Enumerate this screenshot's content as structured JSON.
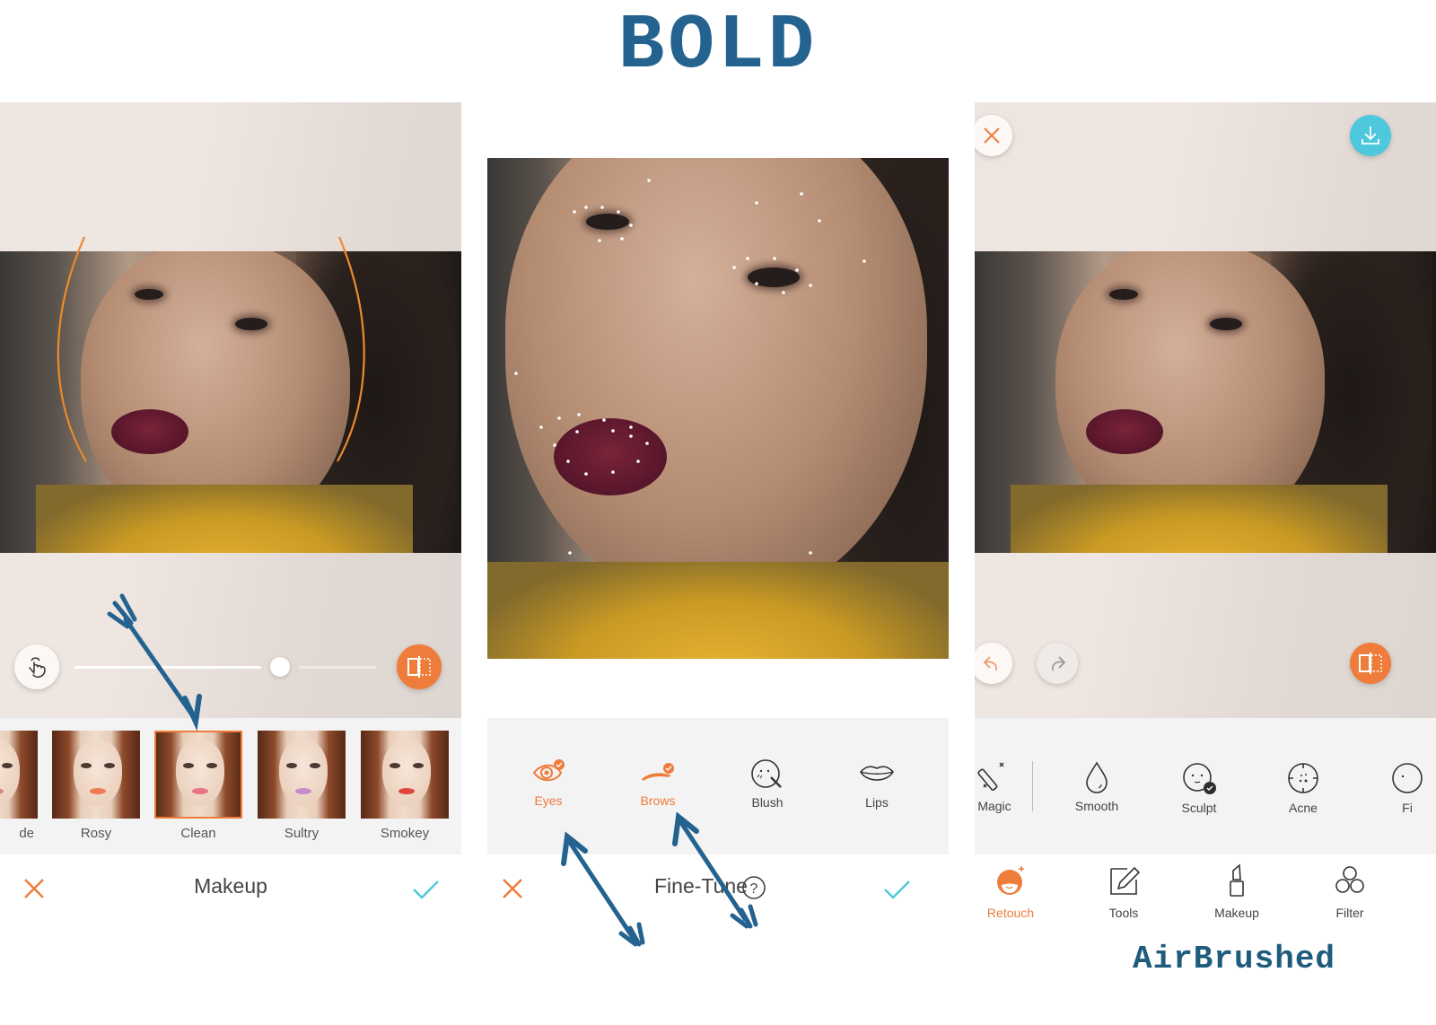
{
  "headline": "BOLD",
  "footer_brand": "AirBrushed",
  "colors": {
    "accent": "#ee7c3b",
    "confirm": "#4dc8dc",
    "annotation": "#24628f",
    "tray_bg": "#f3f3f3"
  },
  "makeup_panel": {
    "title": "Makeup",
    "cancel_icon": "close-icon",
    "confirm_icon": "checkmark-icon",
    "touch_icon": "hand-touch-icon",
    "compare_icon": "compare-split-icon",
    "intensity": 0.74,
    "presets": [
      {
        "label": "Nude",
        "visible_label": "de",
        "lip": "#d88a78",
        "selected": false
      },
      {
        "label": "Rosy",
        "lip": "#f07a54",
        "selected": false
      },
      {
        "label": "Clean",
        "lip": "#e97387",
        "selected": true
      },
      {
        "label": "Sultry",
        "lip": "#c88ac9",
        "selected": false
      },
      {
        "label": "Smokey",
        "lip": "#e0473a",
        "selected": false
      }
    ]
  },
  "finetune_panel": {
    "title": "Fine-Tune",
    "help_icon": "help-circle-icon",
    "cancel_icon": "close-icon",
    "confirm_icon": "checkmark-icon",
    "tools": [
      {
        "label": "Eyes",
        "icon": "eye-icon",
        "active": true
      },
      {
        "label": "Brows",
        "icon": "brow-icon",
        "active": true
      },
      {
        "label": "Blush",
        "icon": "blush-face-icon",
        "active": false
      },
      {
        "label": "Lips",
        "icon": "lips-icon",
        "active": false
      }
    ]
  },
  "retouch_panel": {
    "close_icon": "close-icon",
    "download_icon": "download-icon",
    "undo_icon": "undo-icon",
    "redo_icon": "redo-icon",
    "compare_icon": "compare-split-icon",
    "tools": [
      {
        "label": "Magic",
        "icon": "magic-wand-icon"
      },
      {
        "label": "Smooth",
        "icon": "droplet-icon"
      },
      {
        "label": "Sculpt",
        "icon": "sculpt-face-icon"
      },
      {
        "label": "Acne",
        "icon": "acne-target-icon"
      },
      {
        "label": "Fi",
        "icon": "face-icon"
      }
    ],
    "nav": [
      {
        "label": "Retouch",
        "icon": "retouch-face-icon",
        "active": true
      },
      {
        "label": "Tools",
        "icon": "edit-pencil-icon",
        "active": false
      },
      {
        "label": "Makeup",
        "icon": "lipstick-icon",
        "active": false
      },
      {
        "label": "Filter",
        "icon": "filter-circles-icon",
        "active": false
      }
    ]
  }
}
